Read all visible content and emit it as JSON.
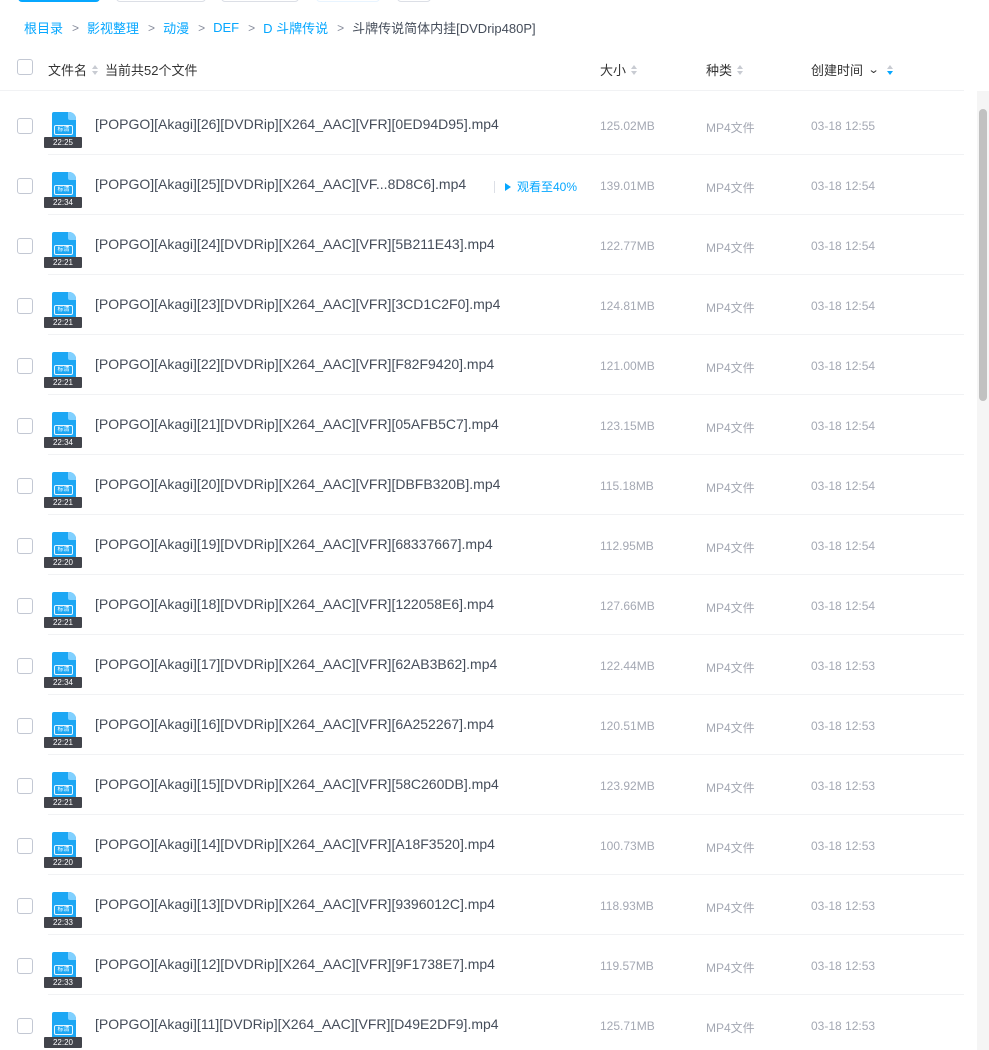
{
  "breadcrumb": {
    "items": [
      "根目录",
      "影视整理",
      "动漫",
      "DEF",
      "D 斗牌传说"
    ],
    "current": "斗牌传说简体内挂[DVDrip480P]",
    "separator": ">"
  },
  "header": {
    "name": "文件名",
    "count": "当前共52个文件",
    "size": "大小",
    "type": "种类",
    "time": "创建时间"
  },
  "colors": {
    "accent": "#06a7ff",
    "muted": "#a4a8b3",
    "text": "#454d5a"
  },
  "files": [
    {
      "name": "[POPGO][Akagi][26][DVDRip][X264_AAC][VFR][0ED94D95].mp4",
      "size": "125.02MB",
      "type": "MP4文件",
      "time": "03-18 12:55",
      "duration": "22:25",
      "quality": "标清"
    },
    {
      "name": "[POPGO][Akagi][25][DVDRip][X264_AAC][VF...8D8C6].mp4",
      "size": "139.01MB",
      "type": "MP4文件",
      "time": "03-18 12:54",
      "duration": "22:34",
      "quality": "标清",
      "progress": "观看至40%"
    },
    {
      "name": "[POPGO][Akagi][24][DVDRip][X264_AAC][VFR][5B211E43].mp4",
      "size": "122.77MB",
      "type": "MP4文件",
      "time": "03-18 12:54",
      "duration": "22:21",
      "quality": "标清"
    },
    {
      "name": "[POPGO][Akagi][23][DVDRip][X264_AAC][VFR][3CD1C2F0].mp4",
      "size": "124.81MB",
      "type": "MP4文件",
      "time": "03-18 12:54",
      "duration": "22:21",
      "quality": "标清"
    },
    {
      "name": "[POPGO][Akagi][22][DVDRip][X264_AAC][VFR][F82F9420].mp4",
      "size": "121.00MB",
      "type": "MP4文件",
      "time": "03-18 12:54",
      "duration": "22:21",
      "quality": "标清"
    },
    {
      "name": "[POPGO][Akagi][21][DVDRip][X264_AAC][VFR][05AFB5C7].mp4",
      "size": "123.15MB",
      "type": "MP4文件",
      "time": "03-18 12:54",
      "duration": "22:34",
      "quality": "标清"
    },
    {
      "name": "[POPGO][Akagi][20][DVDRip][X264_AAC][VFR][DBFB320B].mp4",
      "size": "115.18MB",
      "type": "MP4文件",
      "time": "03-18 12:54",
      "duration": "22:21",
      "quality": "标清"
    },
    {
      "name": "[POPGO][Akagi][19][DVDRip][X264_AAC][VFR][68337667].mp4",
      "size": "112.95MB",
      "type": "MP4文件",
      "time": "03-18 12:54",
      "duration": "22:20",
      "quality": "标清"
    },
    {
      "name": "[POPGO][Akagi][18][DVDRip][X264_AAC][VFR][122058E6].mp4",
      "size": "127.66MB",
      "type": "MP4文件",
      "time": "03-18 12:54",
      "duration": "22:21",
      "quality": "标清"
    },
    {
      "name": "[POPGO][Akagi][17][DVDRip][X264_AAC][VFR][62AB3B62].mp4",
      "size": "122.44MB",
      "type": "MP4文件",
      "time": "03-18 12:53",
      "duration": "22:34",
      "quality": "标清"
    },
    {
      "name": "[POPGO][Akagi][16][DVDRip][X264_AAC][VFR][6A252267].mp4",
      "size": "120.51MB",
      "type": "MP4文件",
      "time": "03-18 12:53",
      "duration": "22:21",
      "quality": "标清"
    },
    {
      "name": "[POPGO][Akagi][15][DVDRip][X264_AAC][VFR][58C260DB].mp4",
      "size": "123.92MB",
      "type": "MP4文件",
      "time": "03-18 12:53",
      "duration": "22:21",
      "quality": "标清"
    },
    {
      "name": "[POPGO][Akagi][14][DVDRip][X264_AAC][VFR][A18F3520].mp4",
      "size": "100.73MB",
      "type": "MP4文件",
      "time": "03-18 12:53",
      "duration": "22:20",
      "quality": "标清"
    },
    {
      "name": "[POPGO][Akagi][13][DVDRip][X264_AAC][VFR][9396012C].mp4",
      "size": "118.93MB",
      "type": "MP4文件",
      "time": "03-18 12:53",
      "duration": "22:33",
      "quality": "标清"
    },
    {
      "name": "[POPGO][Akagi][12][DVDRip][X264_AAC][VFR][9F1738E7].mp4",
      "size": "119.57MB",
      "type": "MP4文件",
      "time": "03-18 12:53",
      "duration": "22:33",
      "quality": "标清"
    },
    {
      "name": "[POPGO][Akagi][11][DVDRip][X264_AAC][VFR][D49E2DF9].mp4",
      "size": "125.71MB",
      "type": "MP4文件",
      "time": "03-18 12:53",
      "duration": "22:20",
      "quality": "标清"
    }
  ]
}
